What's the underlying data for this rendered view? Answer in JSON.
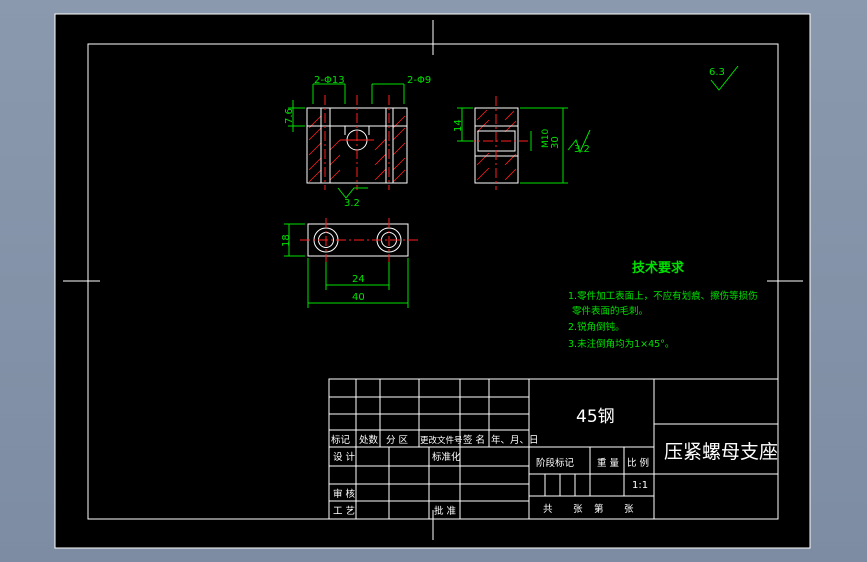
{
  "drawing": {
    "dims": {
      "holes_large": "2-Φ13",
      "holes_small": "2-Φ9",
      "depth": "7.6",
      "roughness_front": "3.2",
      "width_18": "18",
      "spacing_24": "24",
      "length_40": "40",
      "height_14": "14",
      "thread": "M10",
      "height_30": "30",
      "roughness_side": "3.2",
      "roughness_general": "6.3"
    },
    "tech": {
      "title": "技术要求",
      "line1": "1.零件加工表面上，不应有划痕、擦伤等损伤",
      "line2": "零件表面的毛刺。",
      "line3": "2.锐角倒钝。",
      "line4": "3.未注倒角均为1×45°。"
    }
  },
  "title_block": {
    "material": "45钢",
    "part_name": "压紧螺母支座",
    "scale": "1:1",
    "col_mark": "标记",
    "col_count": "处数",
    "col_zone": "分 区",
    "col_doc": "更改文件号",
    "col_sign": "签 名",
    "col_date": "年、月、日",
    "design": "设 计",
    "standard": "标准化",
    "stage": "阶段标记",
    "weight": "重 量",
    "ratio": "比 例",
    "review": "审 核",
    "process": "工 艺",
    "approve": "批 准",
    "total": "共",
    "sheets": "张",
    "sheet_no": "第",
    "sheet_unit": "张"
  }
}
